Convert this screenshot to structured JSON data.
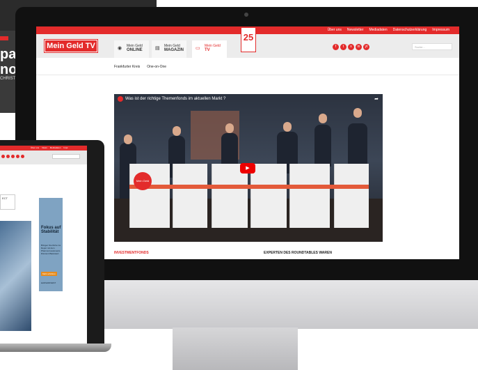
{
  "background_screen": {
    "headline_line1": "pa r",
    "headline_line2": "non",
    "byline": "CHRISTI"
  },
  "site": {
    "top_links": [
      "Über uns",
      "Newsletter",
      "Mediadaten",
      "Datenschutzerklärung",
      "Impressum"
    ],
    "logo": "Mein Geld TV",
    "badge": "25",
    "tabs": [
      {
        "line1": "Mein Geld",
        "line2": "ONLINE",
        "icon": "globe-icon"
      },
      {
        "line1": "Mein Geld",
        "line2": "MAGAZIN",
        "icon": "magazine-icon"
      },
      {
        "line1": "Mein Geld",
        "line2": "TV",
        "icon": "tv-icon"
      }
    ],
    "social": [
      "f",
      "t",
      "x",
      "in",
      "yt"
    ],
    "search_placeholder": "Suche...",
    "subnav": [
      "Frankfurter Kreis",
      "One-on-One"
    ],
    "video": {
      "title": "Was ist der richtige Themenfonds im aktuellen Markt ?",
      "brand_on_desk": "Mein Geld"
    },
    "section_left": "INVESTMENTFONDS",
    "section_right": "EXPERTEN DES ROUNDTABLES WAREN"
  },
  "laptop": {
    "top_links": [
      "Über uns",
      "News",
      "Mediadaten",
      "Impr."
    ],
    "logo_text": "ECT",
    "ad": {
      "title": "Fokus auf Stabilität",
      "body": "Bringen Sie Ruhe ins Depot mit dem Pharma Investments Discount Basiswert",
      "button": "Mehr erfahren",
      "footer": "HANSAINVEST"
    }
  }
}
